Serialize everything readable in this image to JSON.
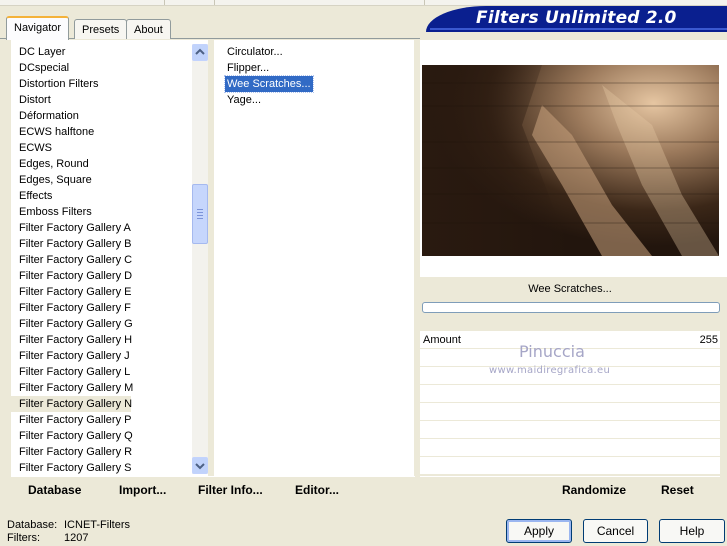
{
  "app": {
    "title": "Filters Unlimited 2.0"
  },
  "tabs": [
    {
      "label": "Navigator",
      "active": true
    },
    {
      "label": "Presets",
      "active": false
    },
    {
      "label": "About",
      "active": false
    }
  ],
  "categories": {
    "items": [
      "DC Layer",
      "DCspecial",
      "Distortion Filters",
      "Distort",
      "Déformation",
      "ECWS halftone",
      "ECWS",
      "Edges, Round",
      "Edges, Square",
      "Effects",
      "Emboss Filters",
      "Filter Factory Gallery A",
      "Filter Factory Gallery B",
      "Filter Factory Gallery C",
      "Filter Factory Gallery D",
      "Filter Factory Gallery E",
      "Filter Factory Gallery F",
      "Filter Factory Gallery G",
      "Filter Factory Gallery H",
      "Filter Factory Gallery J",
      "Filter Factory Gallery L",
      "Filter Factory Gallery M",
      "Filter Factory Gallery N",
      "Filter Factory Gallery P",
      "Filter Factory Gallery Q",
      "Filter Factory Gallery R",
      "Filter Factory Gallery S"
    ],
    "selected": "Filter Factory Gallery N"
  },
  "filters": {
    "items": [
      "Circulator...",
      "Flipper...",
      "Wee Scratches...",
      "Yage..."
    ],
    "selected": "Wee Scratches..."
  },
  "preview": {
    "filter_name": "Wee Scratches...",
    "colors": {
      "dark": "#2a1a10",
      "light": "#d9b896"
    }
  },
  "params": [
    {
      "label": "Amount",
      "value": "255"
    }
  ],
  "watermark": {
    "title": "Pinuccia",
    "url": "www.maidiregrafica.eu"
  },
  "links": {
    "database": "Database",
    "import": "Import...",
    "filter_info": "Filter Info...",
    "editor": "Editor...",
    "randomize": "Randomize",
    "reset": "Reset"
  },
  "status": {
    "database_label": "Database:",
    "database_value": "ICNET-Filters",
    "filters_label": "Filters:",
    "filters_value": "1207"
  },
  "buttons": {
    "apply": "Apply",
    "cancel": "Cancel",
    "help": "Help"
  }
}
